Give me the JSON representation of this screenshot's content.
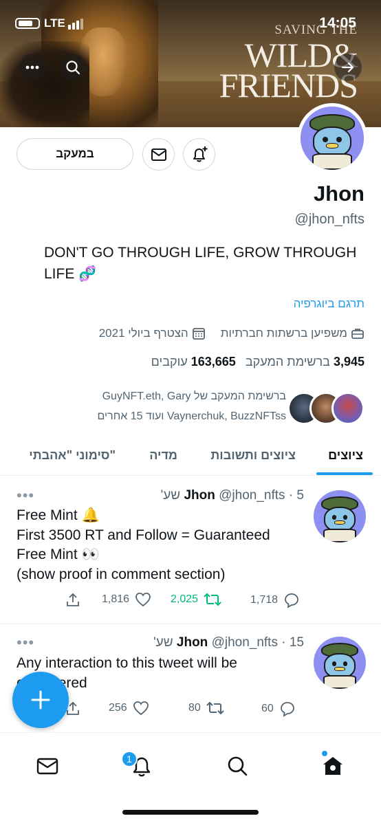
{
  "status_bar": {
    "network": "LTE",
    "time": "14:05"
  },
  "banner": {
    "line1": "SAVING THE",
    "line2": "WILD&",
    "line3": "FRIENDS"
  },
  "profile": {
    "follow_label": "במעקב",
    "name": "Jhon",
    "handle": "@jhon_nfts",
    "bio": "DON'T GO THROUGH LIFE, GROW THROUGH LIFE 🧬",
    "translate_label": "תרגם ביוגרפיה",
    "category": "משפיען ברשתות חברתיות",
    "joined": "הצטרף ביולי 2021",
    "following_count": "3,945",
    "following_label": "ברשימת המעקב",
    "followers_count": "163,665",
    "followers_label": "עוקבים",
    "followed_by_line1": "ברשימת המעקב של GuyNFT.eth, Gary",
    "followed_by_line2": "Vaynerchuk, BuzzNFTss ועוד 15 אחרים"
  },
  "tabs": [
    {
      "label": "ציוצים"
    },
    {
      "label": "ציוצים ותשובות"
    },
    {
      "label": "מדיה"
    },
    {
      "label": "סימוני \"אהבתי\""
    }
  ],
  "tweets": [
    {
      "name": "Jhon",
      "handle": "@jhon_nfts",
      "time": "5 שע'",
      "more": "•••",
      "lines": [
        "Free Mint 🔔",
        "First 3500 RT and Follow  = Guaranteed",
        "Free Mint 👀",
        "(show proof in comment section)"
      ],
      "replies": "1,718",
      "retweets": "2,025",
      "likes": "1,816"
    },
    {
      "name": "Jhon",
      "handle": "@jhon_nfts",
      "time": "15 שע'",
      "more": "•••",
      "lines": [
        "Any interaction to this tweet will be",
        "considered"
      ],
      "replies": "60",
      "retweets": "80",
      "likes": "256"
    }
  ],
  "nav": {
    "notifications_badge": "1"
  },
  "colors": {
    "accent": "#1d9bf0",
    "retweet": "#00ba7c",
    "muted": "#536471"
  }
}
